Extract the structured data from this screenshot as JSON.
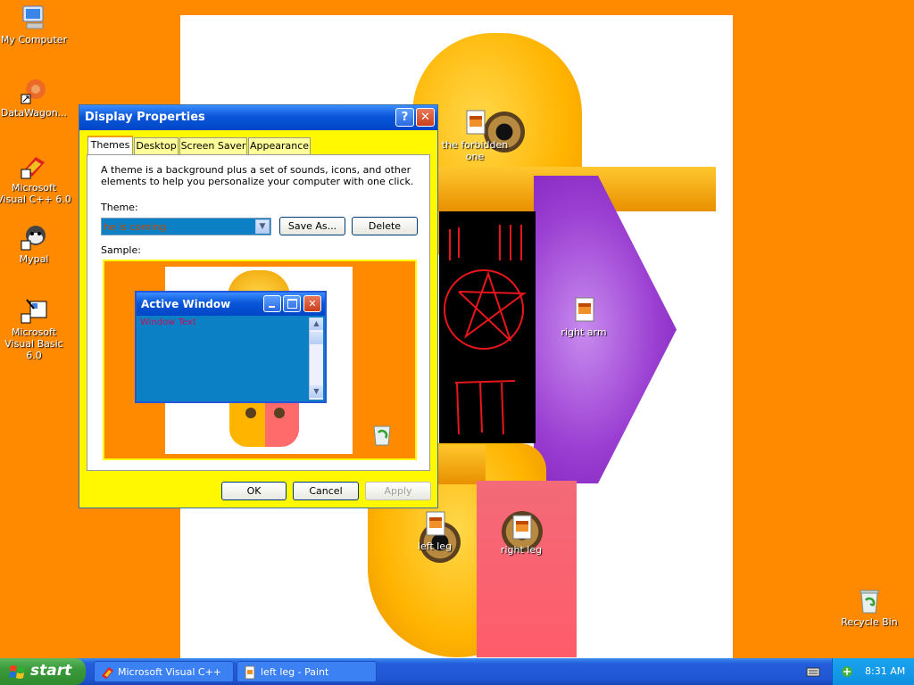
{
  "desktop_icons": [
    {
      "label": "My Computer",
      "icon": "my-computer-icon"
    },
    {
      "label": "DataWagon...",
      "icon": "datawagon-icon"
    },
    {
      "label": "Microsoft Visual C++ 6.0",
      "icon": "visual-cpp-icon"
    },
    {
      "label": "Mypal",
      "icon": "mypal-icon"
    },
    {
      "label": "Microsoft Visual Basic 6.0",
      "icon": "visual-basic-icon"
    },
    {
      "label": "the forbidden one",
      "icon": "paint-image-icon"
    },
    {
      "label": "right arm",
      "icon": "paint-image-icon"
    },
    {
      "label": "left leg",
      "icon": "paint-image-icon"
    },
    {
      "label": "right leg",
      "icon": "paint-image-icon"
    },
    {
      "label": "Recycle Bin",
      "icon": "recycle-bin-icon"
    }
  ],
  "dialog": {
    "title": "Display Properties",
    "tabs": [
      "Themes",
      "Desktop",
      "Screen Saver",
      "Appearance"
    ],
    "active_tab": "Themes",
    "description": "A theme is a background plus a set of sounds, icons, and other elements to help you personalize your computer with one click.",
    "theme_label": "Theme:",
    "theme_value": "he is coming",
    "save_as_label": "Save As...",
    "delete_label": "Delete",
    "sample_label": "Sample:",
    "sample_window_title": "Active Window",
    "sample_window_text": "Window Text",
    "ok_label": "OK",
    "cancel_label": "Cancel",
    "apply_label": "Apply"
  },
  "taskbar": {
    "start_label": "start",
    "tasks": [
      {
        "label": "Microsoft Visual C++"
      },
      {
        "label": "left leg - Paint"
      }
    ],
    "clock": "8:31 AM"
  },
  "colors": {
    "desktop_background": "#FF8A00",
    "dialog_face": "#FFF800",
    "title_bar": "#0A56D8",
    "sample_window_face": "#0C80C4",
    "sample_window_text": "#C01060"
  }
}
